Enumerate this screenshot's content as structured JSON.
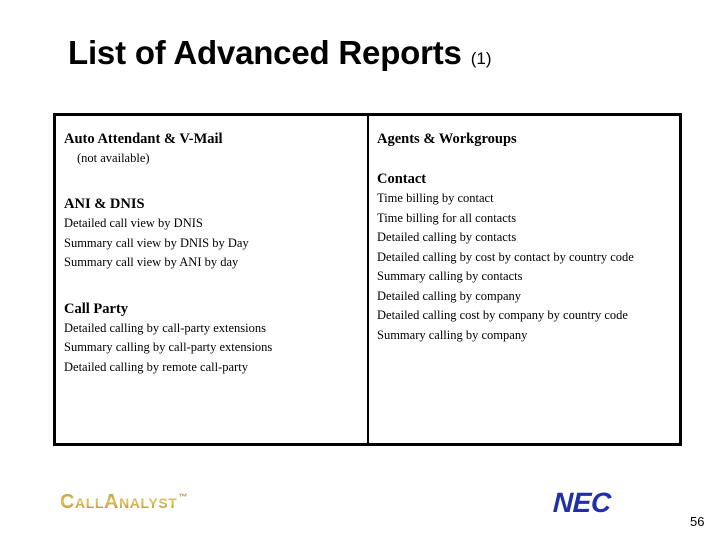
{
  "slide": {
    "title_main": "List of Advanced Reports",
    "title_suffix": "(1)",
    "page_number": "56"
  },
  "table": {
    "left_column": {
      "sections": [
        {
          "heading": "Auto Attendant & V-Mail",
          "note": "(not available)",
          "items": []
        },
        {
          "heading": "ANI & DNIS",
          "items": [
            "Detailed call view by DNIS",
            "Summary call view by DNIS by Day",
            "Summary call view by ANI by day"
          ]
        },
        {
          "heading": "Call Party",
          "items": [
            "Detailed calling by call-party extensions",
            "Summary calling by call-party extensions",
            "Detailed calling by remote call-party"
          ]
        }
      ]
    },
    "right_column": {
      "sections": [
        {
          "heading": "Agents & Workgroups",
          "items": []
        },
        {
          "heading": "Contact",
          "items": [
            "Time billing by contact",
            "Time billing for all contacts",
            "Detailed calling by contacts",
            "Detailed calling by cost by contact by country code",
            "Summary calling by contacts",
            "Detailed calling by company",
            "Detailed calling cost by company by country code",
            "Summary calling by company"
          ]
        }
      ]
    }
  },
  "footer": {
    "callanalyst_logo_text": "CallAnalyst",
    "callanalyst_trademark": "™",
    "nec_logo_text": "NEC"
  },
  "colors": {
    "text": "#000000",
    "border": "#000000",
    "callanalyst_gold": "#c2a03a",
    "nec_blue": "#2230a8",
    "background": "#ffffff"
  }
}
